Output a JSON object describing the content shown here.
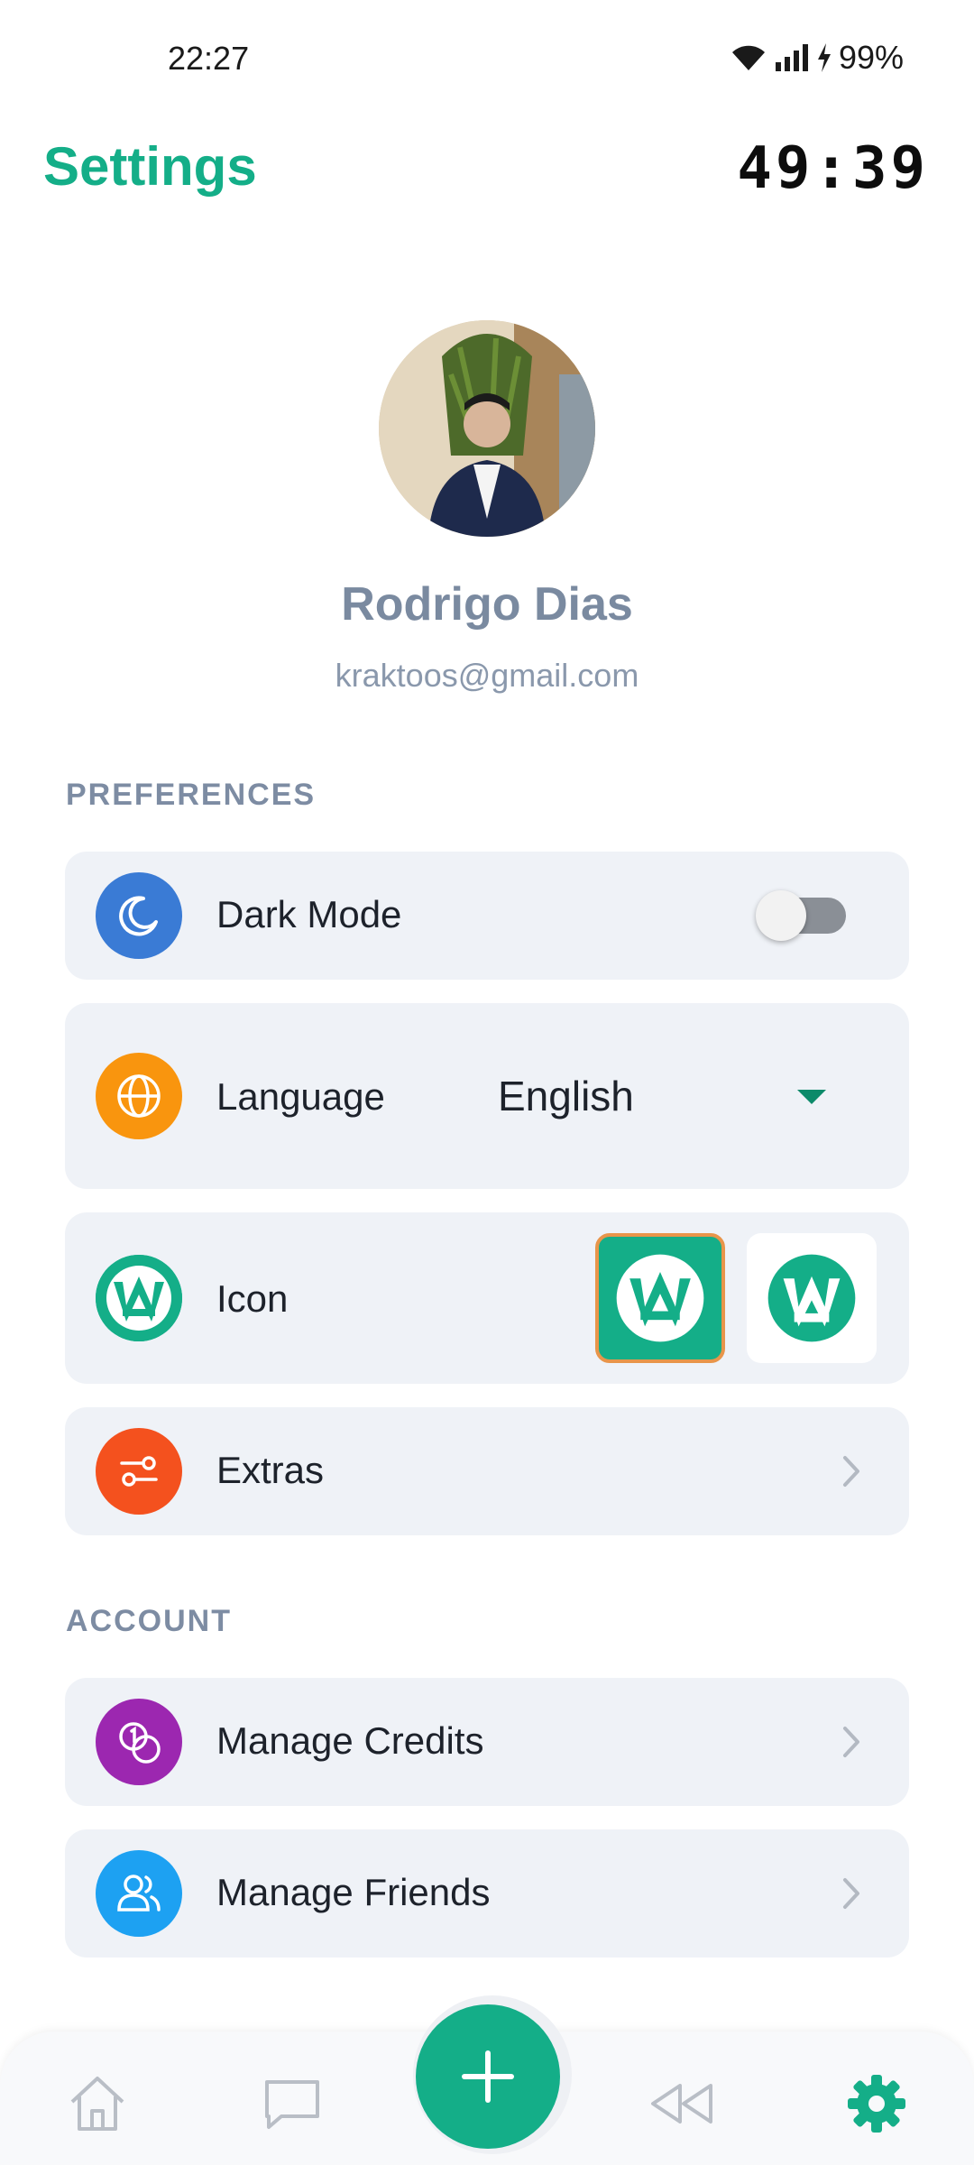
{
  "status": {
    "time": "22:27",
    "battery": "99%"
  },
  "header": {
    "title": "Settings",
    "timer": "49:39"
  },
  "profile": {
    "name": "Rodrigo Dias",
    "email": "kraktoos@gmail.com"
  },
  "preferences": {
    "section_label": "PREFERENCES",
    "dark_mode": {
      "label": "Dark Mode",
      "enabled": false
    },
    "language": {
      "label": "Language",
      "value": "English"
    },
    "icon": {
      "label": "Icon",
      "selected": "green"
    },
    "extras": {
      "label": "Extras"
    }
  },
  "account": {
    "section_label": "ACCOUNT",
    "manage_credits": {
      "label": "Manage Credits"
    },
    "manage_friends": {
      "label": "Manage Friends"
    }
  },
  "nav": {
    "items": [
      "home-icon",
      "chat-icon",
      "add-icon",
      "rewind-icon",
      "settings-icon"
    ],
    "active": "settings"
  },
  "colors": {
    "accent": "#14ae88",
    "dark_mode_icon": "#3a7bd5",
    "language_icon": "#f9950e",
    "extras_icon": "#f4511e",
    "credits_icon": "#9c27b0",
    "friends_icon": "#1da1f2",
    "selected_border": "#e8954a"
  }
}
